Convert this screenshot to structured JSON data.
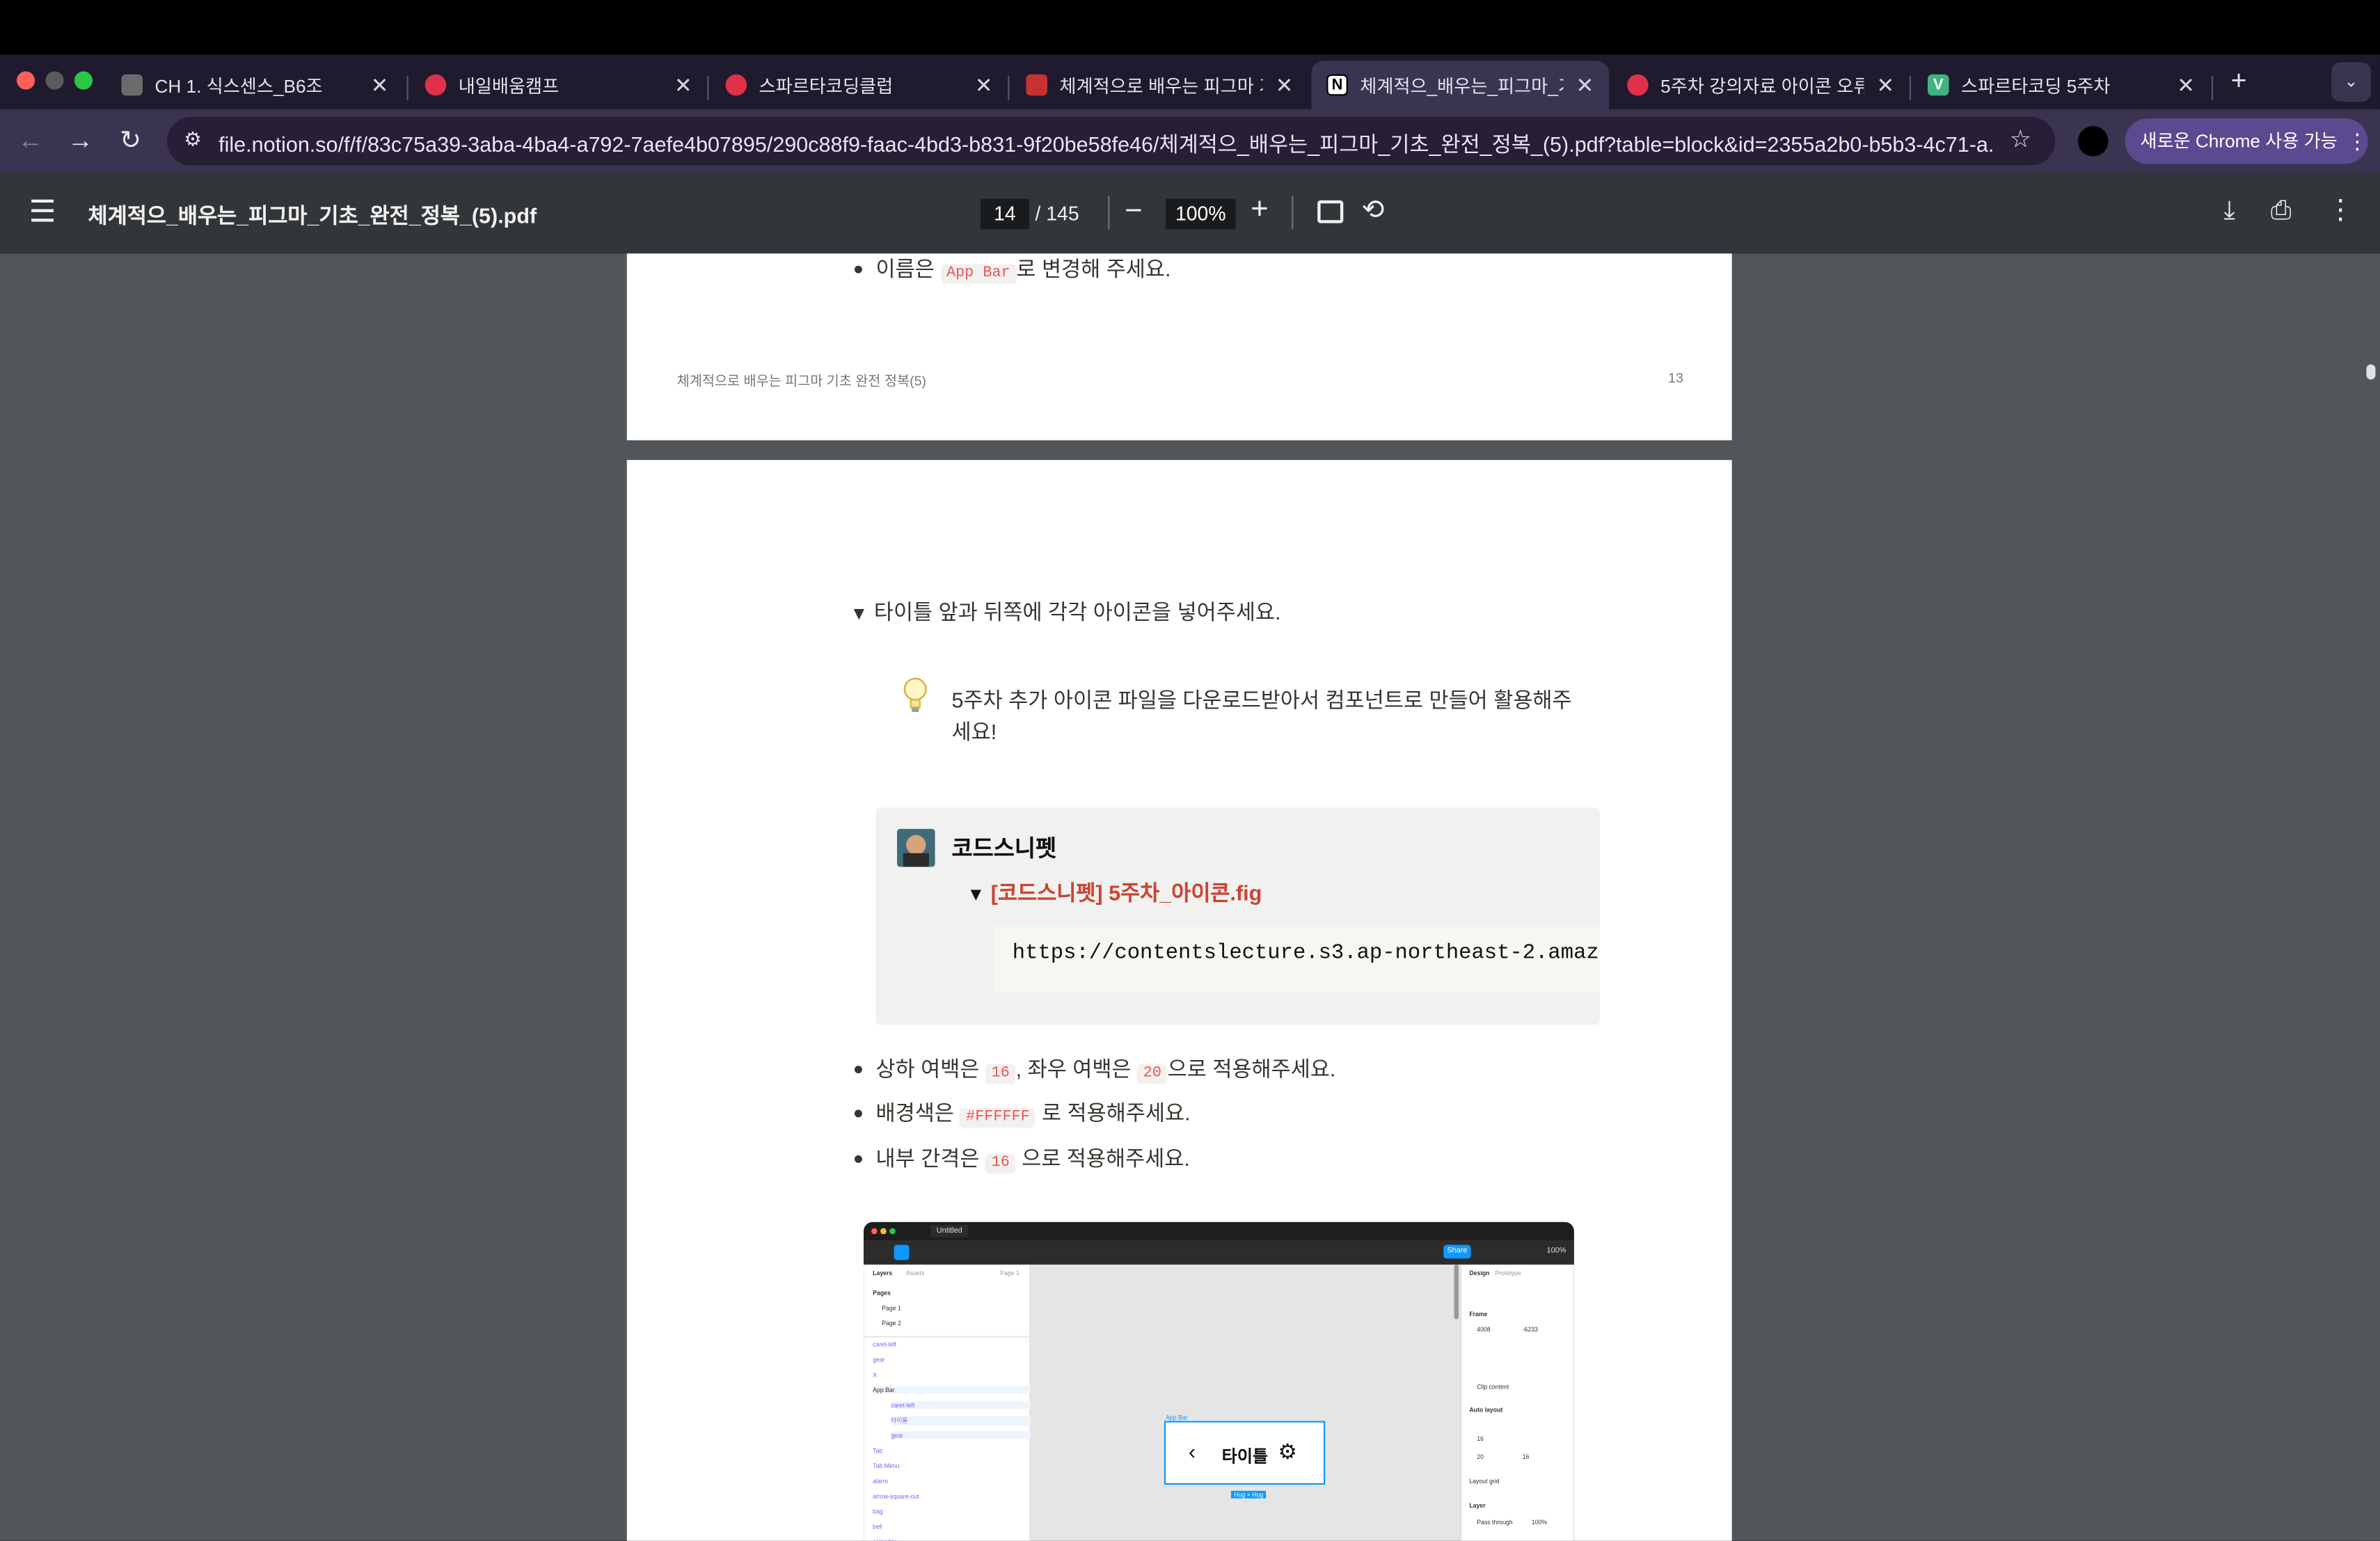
{
  "tabs": [
    {
      "title": "CH 1. 식스센스_B6조",
      "icon": "notion-team-icon"
    },
    {
      "title": "내일배움캠프",
      "icon": "sparta-heart-icon"
    },
    {
      "title": "스파르타코딩클럽",
      "icon": "sparta-heart-icon"
    },
    {
      "title": "체계적으로 배우는 피그마 기초",
      "icon": "red-book-icon"
    },
    {
      "title": "체계적으_배우는_피그마_기초",
      "icon": "notion-icon"
    },
    {
      "title": "5주차 강의자료 아이콘 오류 |",
      "icon": "sparta-heart-icon"
    },
    {
      "title": "스파르타코딩 5주차",
      "icon": "v-icon"
    }
  ],
  "address": {
    "url": "file.notion.so/f/f/83c75a39-3aba-4ba4-a792-7aefe4b07895/290c88f9-faac-4bd3-b831-9f20be58fe46/체계적으_배우는_피그마_기초_완전_정복_(5).pdf?table=block&id=2355a2b0-b5b3-4c71-a...",
    "chrome_button": "새로운 Chrome 사용 가능"
  },
  "pdf": {
    "filename": "체계적으_배우는_피그마_기초_완전_정복_(5).pdf",
    "page": "14",
    "total": "/ 145",
    "zoom": "100%"
  },
  "page13": {
    "bullet_prefix": "이름은",
    "bullet_code": "App Bar",
    "bullet_suffix": "로 변경해 주세요.",
    "footer_title": "체계적으로 배우는 피그마 기초 완전 정복(5)",
    "page_number": "13"
  },
  "page14": {
    "toggle_heading": "타이틀 앞과 뒤쪽에 각각 아이콘을 넣어주세요.",
    "callout_line1": "5주차 추가 아이콘 파일을 다운로드받아서 컴포넌트로 만들어 활용해주",
    "callout_line2": "세요!",
    "snippet_title": "코드스니펫",
    "snippet_toggle": "[코드스니펫] 5주차_아이콘.fig",
    "snippet_code": "https://contentslecture.s3.ap-northeast-2.amaz",
    "b1_a": "상하 여백은",
    "b1_c1": "16",
    "b1_b": ", 좌우 여백은",
    "b1_c2": "20",
    "b1_d": "으로 적용해주세요.",
    "b2_a": "배경색은",
    "b2_c": "#FFFFFF",
    "b2_d": "로 적용해주세요.",
    "b3_a": "내부 간격은",
    "b3_c": "16",
    "b3_d": "으로 적용해주세요."
  },
  "figma": {
    "file": "Untitled",
    "share": "Share",
    "zoom": "100%",
    "tabs": [
      "Layers",
      "Assets"
    ],
    "page_label": "Page 1",
    "pages_header": "Pages",
    "pages": [
      "Page 1",
      "Page 2"
    ],
    "layers": [
      "caret-left",
      "gear",
      "X",
      "App Bar",
      "caret-left",
      "타이틀",
      "gear",
      "Tab",
      "Tab Menu",
      "alarm",
      "arrow-square-out",
      "bag",
      "bell",
      "calendar"
    ],
    "frame_name": "App Bar",
    "frame_title": "타이틀",
    "frame_size": "Hug × Hug",
    "right_tabs": [
      "Design",
      "Prototype"
    ],
    "props": {
      "frame": "Frame",
      "x": "4008",
      "y": "-6233",
      "auto_layout": "Auto layout",
      "gap": "16",
      "h_pad": "20",
      "v_pad": "16",
      "layer": "Layer",
      "pass": "Pass through",
      "opacity": "100%",
      "clip": "Clip content",
      "layout_grid": "Layout grid"
    }
  }
}
